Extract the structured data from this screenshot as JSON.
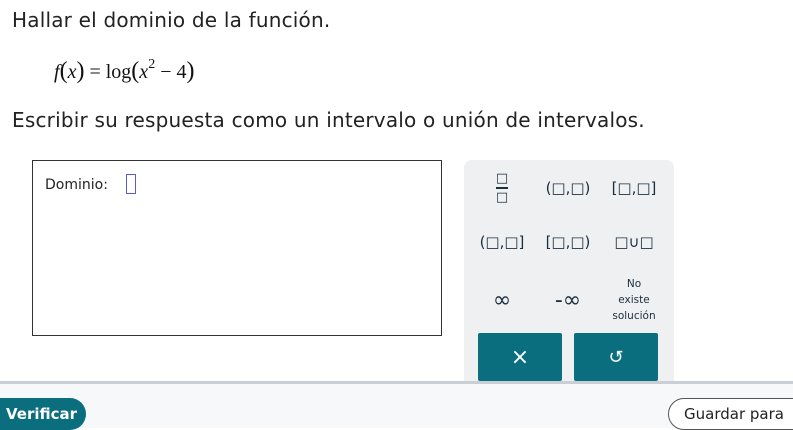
{
  "question": {
    "prompt": "Hallar el dominio de la función.",
    "formula": {
      "fname": "f",
      "var": "x",
      "equals": "=",
      "log": "log",
      "exponent": "2",
      "minus": "−",
      "constant": "4"
    },
    "instruction": "Escribir su respuesta como un intervalo o unión de intervalos."
  },
  "answer": {
    "label": "Dominio:",
    "value": ""
  },
  "keypad": {
    "fraction": {
      "num": "□",
      "den": "□"
    },
    "open_open": "(□,□)",
    "closed_closed": "[□,□]",
    "open_closed": "(□,□]",
    "closed_open": "[□,□)",
    "union": "□∪□",
    "infinity": "∞",
    "neg_infinity": "-∞",
    "no_solution": {
      "line1": "No",
      "line2": "existe",
      "line3": "solución"
    },
    "clear": "×",
    "undo": "↺"
  },
  "footer": {
    "verify": "Verificar",
    "save": "Guardar para"
  }
}
